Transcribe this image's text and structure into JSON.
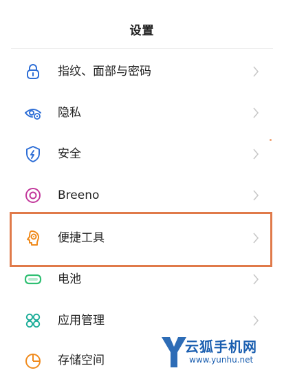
{
  "header": {
    "title": "设置"
  },
  "settings_items": [
    {
      "label": "指纹、面部与密码",
      "icon": "lock-icon",
      "color": "#2f6fd6"
    },
    {
      "label": "隐私",
      "icon": "privacy-eye-icon",
      "color": "#2f6fd6"
    },
    {
      "label": "安全",
      "icon": "shield-icon",
      "color": "#2f6fd6"
    },
    {
      "label": "Breeno",
      "icon": "breeno-icon",
      "color": "#c2389b"
    },
    {
      "label": "便捷工具",
      "icon": "convenience-tools-icon",
      "color": "#f08a1c"
    },
    {
      "label": "电池",
      "icon": "battery-icon",
      "color": "#2fbf72"
    },
    {
      "label": "应用管理",
      "icon": "app-management-icon",
      "color": "#1fae9a"
    },
    {
      "label": "存储空间",
      "icon": "storage-pie-icon",
      "color": "#f08a1c"
    }
  ],
  "highlight": {
    "color": "#e07a4a",
    "target": "便捷工具"
  },
  "watermark": {
    "letter": "Y",
    "name": "云狐手机网",
    "url": "www.yunhu.net",
    "color": "#1b5fb0"
  }
}
